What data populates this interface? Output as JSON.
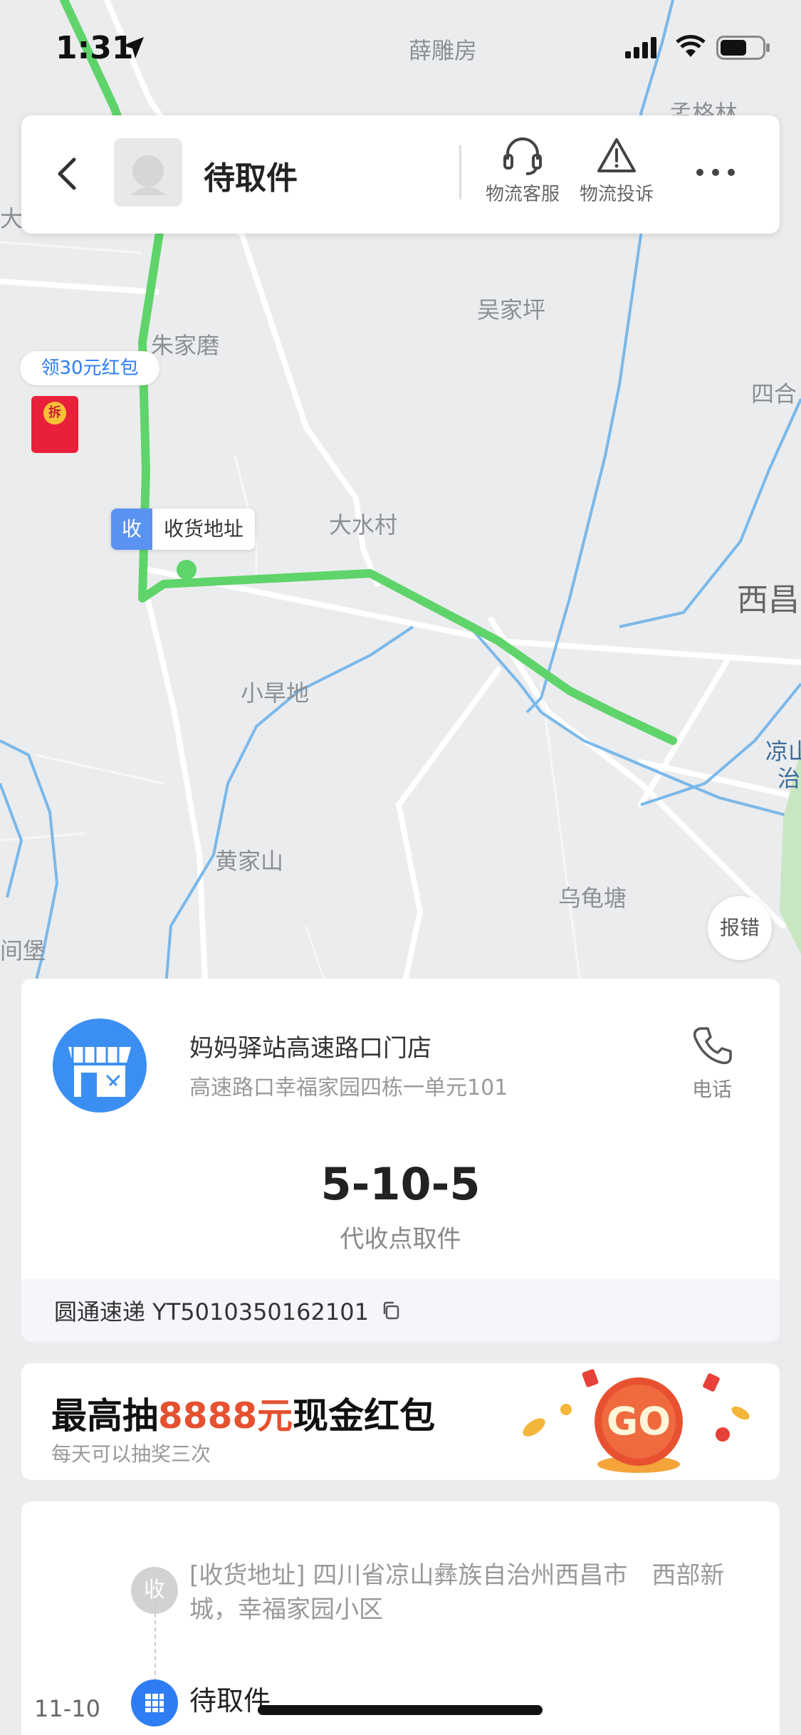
{
  "status": {
    "time": "1:31"
  },
  "header": {
    "title": "待取件",
    "actions": [
      {
        "label": "物流客服",
        "icon": "headset-icon"
      },
      {
        "label": "物流投诉",
        "icon": "warning-icon"
      }
    ],
    "more_icon": "more-icon"
  },
  "map": {
    "labels": [
      {
        "text": "薛雕房"
      },
      {
        "text": "孟格林"
      },
      {
        "text": "朱家磨"
      },
      {
        "text": "吴家坪"
      },
      {
        "text": "四合"
      },
      {
        "text": "大水村"
      },
      {
        "text": "西昌"
      },
      {
        "text": "小旱地"
      },
      {
        "text": "凉山"
      },
      {
        "text": "治"
      },
      {
        "text": "黄家山"
      },
      {
        "text": "乌龟塘"
      },
      {
        "text": "间堡"
      },
      {
        "text": "大水"
      }
    ],
    "red_packet_pill": "领30元红包",
    "red_packet_seal": "拆",
    "address_tag_key": "收",
    "address_tag_value": "收货地址",
    "report_button": "报错",
    "colors": {
      "route": "#5fd46a",
      "water": "#7ab8ea",
      "road": "#ffffff",
      "land": "#ebecee"
    }
  },
  "station": {
    "name": "妈妈驿站高速路口门店",
    "address": "高速路口幸福家园四栋一单元101",
    "phone_label": "电话",
    "pickup_code": "5-10-5",
    "pickup_sub": "代收点取件",
    "tracking": "圆通速递 YT5010350162101"
  },
  "promo": {
    "title_prefix": "最高抽",
    "title_amount": "8888元",
    "title_suffix": "现金红包",
    "subtitle": "每天可以抽奖三次",
    "go_label": "GO"
  },
  "timeline": {
    "receive_badge": "收",
    "receive_text": "[收货地址] 四川省凉山彝族自治州西昌市　西部新城，幸福家园小区",
    "event_date": "11-10",
    "event_title": "待取件"
  }
}
